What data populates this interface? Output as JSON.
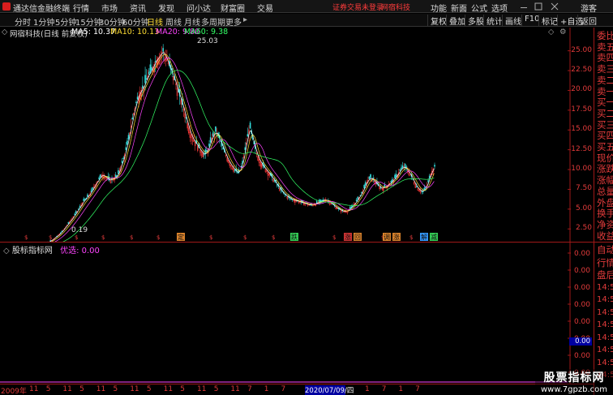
{
  "titlebar": {
    "app_name": "通达信金融终端",
    "menus": [
      "行情",
      "市场",
      "资讯",
      "发现",
      "问小达",
      "财富圈",
      "交易"
    ],
    "status": "证券交易未登录",
    "broker": "网宿科技",
    "right_menus": [
      "功能",
      "新面",
      "公式",
      "选项"
    ],
    "guest": "游客"
  },
  "period_tabs": {
    "items": [
      "分时",
      "1分钟",
      "5分钟",
      "15分钟",
      "30分钟",
      "60分钟",
      "日线",
      "周线",
      "月线",
      "多周期",
      "更多"
    ],
    "active": "日线",
    "more_arrow": "▸"
  },
  "toolbox": {
    "items": [
      "复权",
      "叠加",
      "多股",
      "统计",
      "画线",
      "F10",
      "标记",
      "+自选",
      "返回"
    ]
  },
  "legend": {
    "stock": "网宿科技(日线 前复权)",
    "ma5": "MA5: 10.37",
    "ma10": "MA10: 10.13",
    "ma20": "MA20: 9.80",
    "ma60": "MA60: 9.38",
    "colors": {
      "ma5": "#ffffff",
      "ma10": "#ffdd33",
      "ma20": "#ff44ff",
      "ma60": "#33ff66"
    }
  },
  "chart_data": {
    "type": "candlestick",
    "title": "网宿科技(日线 前复权)",
    "y_ticks": [
      "25.00",
      "22.50",
      "20.00",
      "17.50",
      "15.00",
      "12.50",
      "10.00",
      "7.50",
      "5.00",
      "2.50"
    ],
    "ylim": [
      1.5,
      26.5
    ],
    "x_range": [
      "2009年",
      "2020/07/09/四"
    ],
    "annotations": {
      "high": "25.03",
      "low": "0.19"
    },
    "close_trend": [
      0.45,
      0.4,
      0.35,
      0.3,
      0.28,
      0.25,
      0.22,
      0.2,
      0.22,
      0.28,
      0.35,
      0.5,
      0.65,
      0.9,
      1.2,
      1.6,
      2.0,
      2.6,
      3.2,
      3.8,
      4.5,
      5.2,
      6.0,
      6.5,
      7.1,
      8.0,
      8.7,
      9.4,
      9.0,
      8.6,
      8.9,
      9.2,
      10.5,
      12.0,
      14.0,
      16.5,
      18.5,
      19.8,
      20.5,
      21.8,
      22.5,
      23.6,
      24.2,
      25.0,
      24.0,
      22.8,
      21.5,
      20.0,
      18.5,
      16.8,
      15.0,
      13.8,
      13.2,
      12.4,
      11.8,
      12.5,
      14.0,
      14.8,
      14.0,
      12.6,
      11.5,
      10.6,
      10.0,
      9.5,
      10.5,
      13.0,
      15.5,
      13.5,
      11.8,
      10.8,
      10.2,
      9.6,
      9.0,
      8.3,
      7.6,
      7.0,
      6.6,
      6.3,
      6.1,
      6.0,
      5.8,
      5.7,
      5.5,
      5.6,
      5.8,
      6.0,
      6.2,
      6.0,
      5.6,
      5.2,
      4.9,
      4.7,
      4.8,
      5.2,
      5.8,
      6.5,
      7.3,
      8.4,
      9.0,
      8.6,
      8.0,
      7.6,
      7.8,
      8.2,
      8.6,
      9.2,
      10.0,
      10.4,
      9.8,
      9.0,
      8.0,
      7.4,
      7.2,
      8.0,
      9.5,
      10.4
    ],
    "signals": [
      {
        "label": "定",
        "color": "#d9822b"
      },
      {
        "label": "跌",
        "color": "#33cc55"
      },
      {
        "label": "涨",
        "color": "#cc3333"
      },
      {
        "label": "回",
        "color": "#d9822b"
      },
      {
        "label": "调",
        "color": "#d9822b"
      },
      {
        "label": "涨",
        "color": "#d9822b"
      },
      {
        "label": "解",
        "color": "#3399ff"
      },
      {
        "label": "减",
        "color": "#33cc55"
      }
    ]
  },
  "sidepanel": {
    "items": [
      "委比",
      "卖五",
      "卖四",
      "卖三",
      "卖二",
      "卖一",
      "买一",
      "买二",
      "买三",
      "买四",
      "买五",
      "现价",
      "涨跌",
      "涨幅",
      "总量",
      "外盘",
      "换手",
      "净资",
      "收益"
    ],
    "lower_items": [
      "自动",
      "行情",
      "盘后",
      "14:50",
      "14:50",
      "14:50",
      "14:50",
      "14:50",
      "14:50",
      "14:50",
      "14:5"
    ]
  },
  "subchart": {
    "title": "股标指标网",
    "series_label": "优选: 0.00",
    "y_ticks": [
      "0.00",
      "0.00",
      "0.00",
      "0.00",
      "0.00",
      "0.00",
      "0.00",
      "0.00"
    ],
    "current_value": "0.00"
  },
  "bottom_axis": {
    "year_label": "2009年",
    "ticks": [
      "11",
      "5",
      "11",
      "5",
      "11",
      "5",
      "11",
      "5",
      "11",
      "5",
      "11",
      "5",
      "11",
      "7",
      "1",
      "7",
      "1",
      "7",
      "1",
      "7",
      "1",
      "7",
      "1",
      "7"
    ],
    "date": "2020/07/09/四"
  },
  "watermark": {
    "line1": "股票指标网",
    "line2": "www.7gpzb.com"
  }
}
